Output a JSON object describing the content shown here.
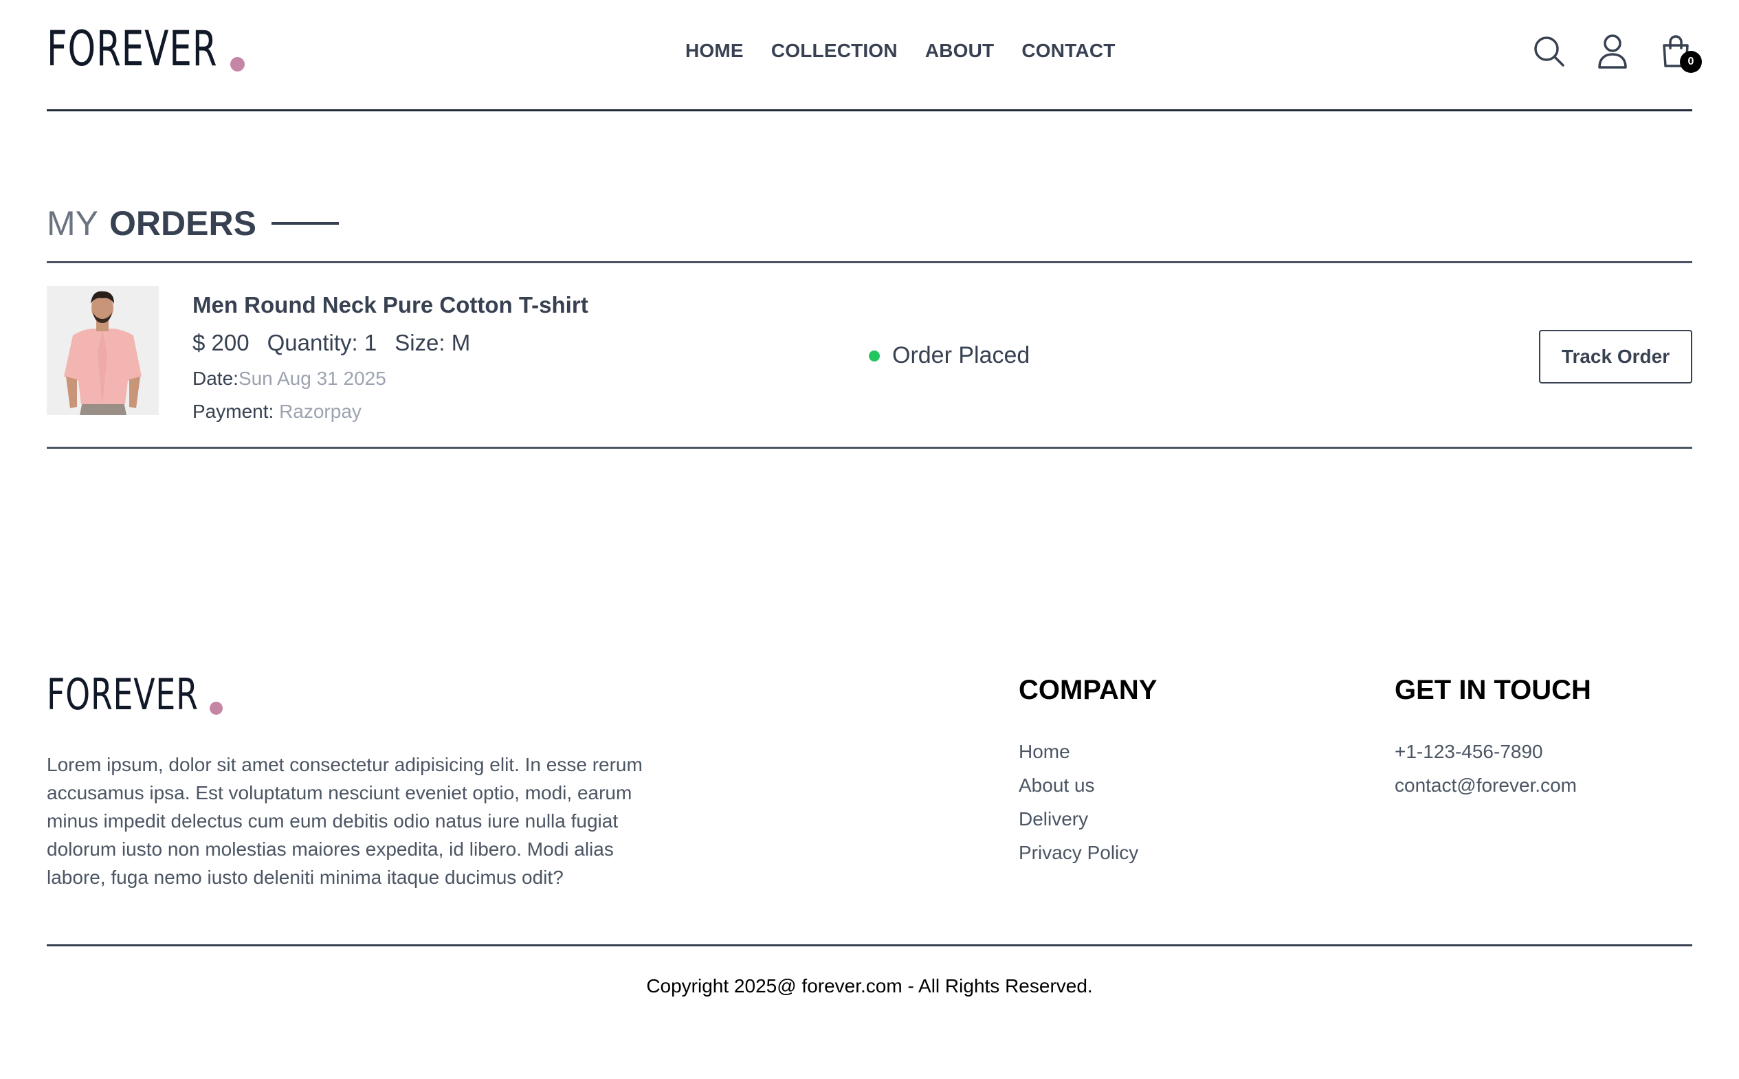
{
  "brand": {
    "name": "FOREVER",
    "dot_color": "#c586a5"
  },
  "nav": [
    {
      "label": "HOME"
    },
    {
      "label": "COLLECTION"
    },
    {
      "label": "ABOUT"
    },
    {
      "label": "CONTACT"
    }
  ],
  "header_icons": {
    "search": "search-icon",
    "profile": "profile-icon",
    "cart": "cart-icon",
    "cart_count": "0"
  },
  "page_title": {
    "light": "MY",
    "bold": "ORDERS"
  },
  "orders": [
    {
      "name": "Men Round Neck Pure Cotton T-shirt",
      "price": "$ 200",
      "quantity": "Quantity: 1",
      "size": "Size: M",
      "date_label": "Date:",
      "date_value": "Sun Aug 31 2025",
      "payment_label": "Payment:",
      "payment_value": "Razorpay",
      "status": "Order Placed",
      "status_color": "#22c55e",
      "action_label": "Track Order"
    }
  ],
  "footer": {
    "description": "Lorem ipsum, dolor sit amet consectetur adipisicing elit. In esse rerum accusamus ipsa. Est voluptatum nesciunt eveniet optio, modi, earum minus impedit delectus cum eum debitis odio natus iure nulla fugiat dolorum iusto non molestias maiores expedita, id libero. Modi alias labore, fuga nemo iusto deleniti minima itaque ducimus odit?",
    "company_title": "COMPANY",
    "company_links": [
      "Home",
      "About us",
      "Delivery",
      "Privacy Policy"
    ],
    "contact_title": "GET IN TOUCH",
    "contact_items": [
      "+1-123-456-7890",
      "contact@forever.com"
    ],
    "copyright": "Copyright 2025@ forever.com - All Rights Reserved."
  }
}
